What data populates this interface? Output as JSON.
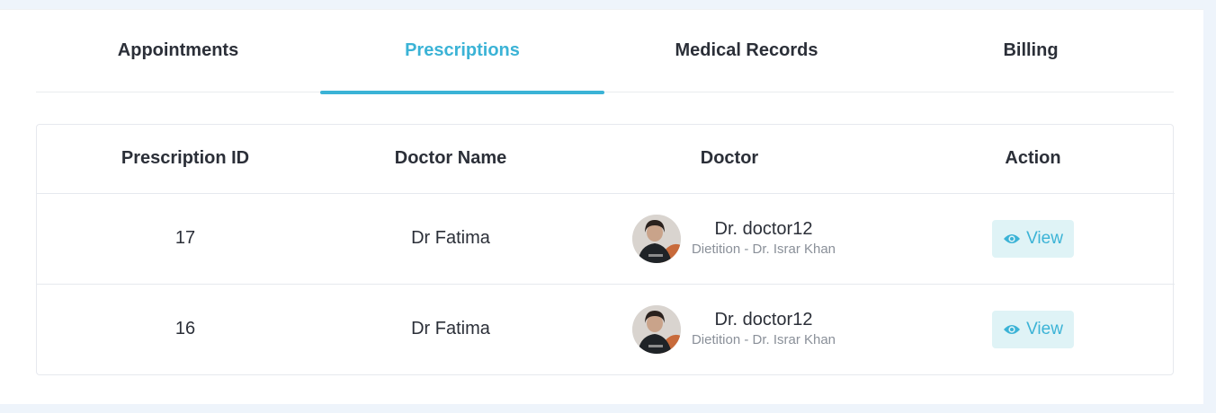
{
  "tabs": [
    {
      "label": "Appointments"
    },
    {
      "label": "Prescriptions"
    },
    {
      "label": "Medical Records"
    },
    {
      "label": "Billing"
    }
  ],
  "active_tab": "Prescriptions",
  "table": {
    "headers": [
      "Prescription ID",
      "Doctor Name",
      "Doctor",
      "Action"
    ],
    "rows": [
      {
        "id": "17",
        "doctor_name": "Dr Fatima",
        "doctor": {
          "name": "Dr. doctor12",
          "subtitle": "Dietition - Dr. Israr Khan",
          "avatar_icon": "doctor-avatar-photo"
        },
        "action": {
          "label": "View",
          "icon": "eye-icon"
        }
      },
      {
        "id": "16",
        "doctor_name": "Dr Fatima",
        "doctor": {
          "name": "Dr. doctor12",
          "subtitle": "Dietition - Dr. Israr Khan",
          "avatar_icon": "doctor-avatar-photo"
        },
        "action": {
          "label": "View",
          "icon": "eye-icon"
        }
      }
    ]
  },
  "colors": {
    "accent": "#3bb3d6",
    "view_button_bg": "#dff3f6",
    "page_bg": "#eef4fb"
  }
}
